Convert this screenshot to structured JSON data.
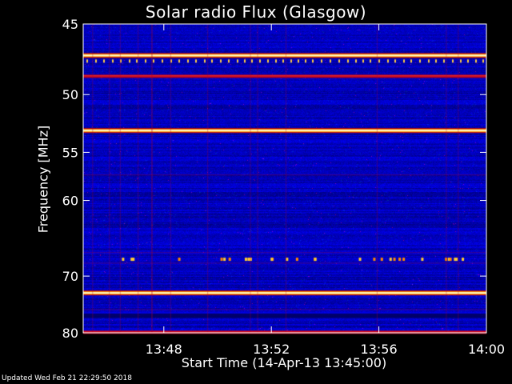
{
  "chart_data": {
    "type": "heatmap",
    "title": "Solar radio Flux (Glasgow)",
    "xlabel": "Start Time (14-Apr-13 13:45:00)",
    "ylabel": "Frequency [MHz]",
    "x_ticks": [
      "13:48",
      "13:52",
      "13:56",
      "14:00"
    ],
    "x_tick_minutes": [
      48,
      52,
      56,
      60
    ],
    "x_range_minutes": [
      45,
      60
    ],
    "y_ticks": [
      45,
      50,
      55,
      60,
      70,
      80
    ],
    "y_range_mhz": [
      45,
      80
    ],
    "y_scale": "reciprocal",
    "colormap": [
      "#000070",
      "#0000dd",
      "#1a1aff",
      "#d01010",
      "#ff9900",
      "#ffffc0"
    ],
    "bright_bands_mhz": [
      {
        "freq": 47.1,
        "intensity": "saturated"
      },
      {
        "freq": 48.6,
        "intensity": "medium"
      },
      {
        "freq": 53.0,
        "intensity": "saturated"
      },
      {
        "freq": 72.7,
        "intensity": "saturated"
      },
      {
        "freq": 79.9,
        "intensity": "medium"
      }
    ],
    "dark_bands_mhz": [
      76.7
    ],
    "grid": false
  },
  "footer": "Updated Wed Feb 21 22:29:50 2018"
}
